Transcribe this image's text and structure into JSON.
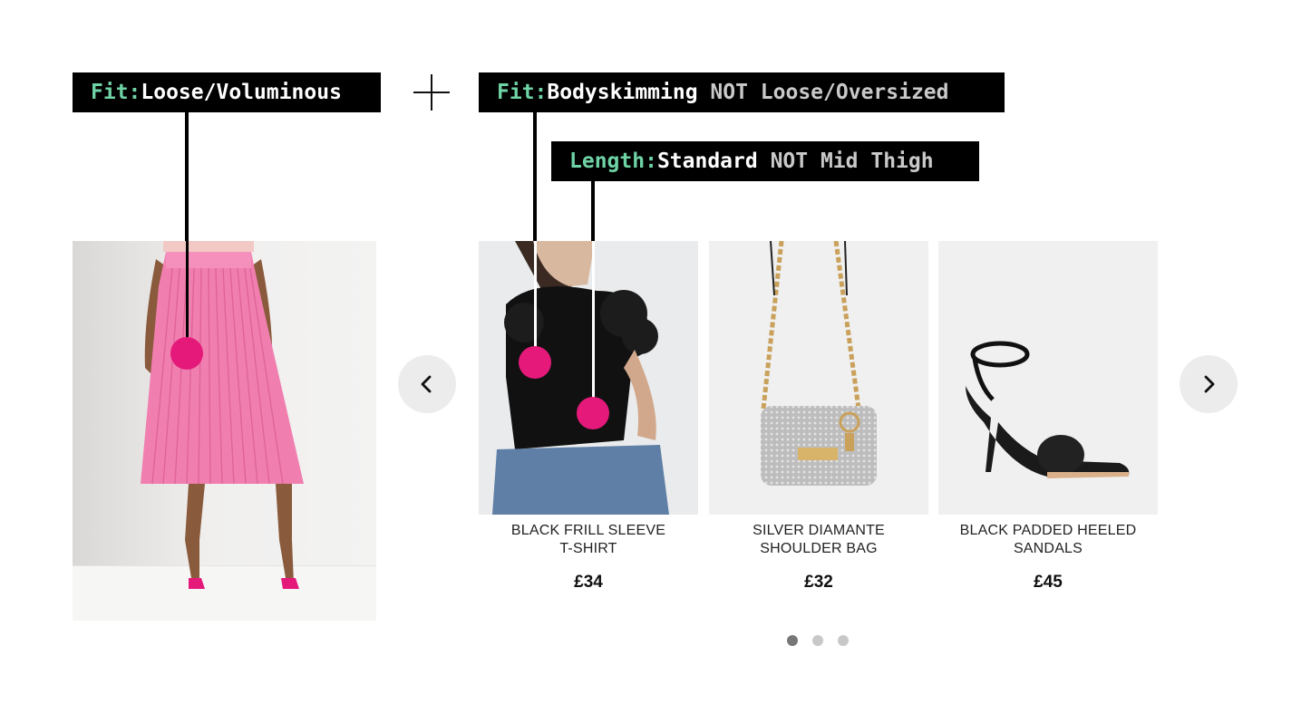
{
  "annotations": {
    "left_fit": {
      "key": "Fit:",
      "value": "Loose/Voluminous",
      "negation": ""
    },
    "right_fit": {
      "key": "Fit:",
      "value": "Bodyskimming",
      "negation": " NOT Loose/Oversized"
    },
    "right_length": {
      "key": "Length:",
      "value": "Standard",
      "negation": " NOT Mid Thigh"
    }
  },
  "colors": {
    "tag_background": "#000000",
    "tag_key": "#6fd3a6",
    "hotspot": "#e5197a",
    "nav_button": "#ececec"
  },
  "main_product": {
    "image": "pink-pleated-midi-skirt-photo"
  },
  "carousel": {
    "prev_icon": "chevron-left-icon",
    "next_icon": "chevron-right-icon",
    "products": [
      {
        "title_line1": "BLACK FRILL SLEEVE",
        "title_line2": "T-SHIRT",
        "price": "£34",
        "image": "black-frill-sleeve-tshirt-photo"
      },
      {
        "title_line1": "SILVER DIAMANTE",
        "title_line2": "SHOULDER BAG",
        "price": "£32",
        "image": "silver-diamante-shoulder-bag-photo"
      },
      {
        "title_line1": "BLACK PADDED HEELED",
        "title_line2": "SANDALS",
        "price": "£45",
        "image": "black-padded-heeled-sandals-photo"
      }
    ],
    "page_count": 3,
    "active_page": 1
  }
}
